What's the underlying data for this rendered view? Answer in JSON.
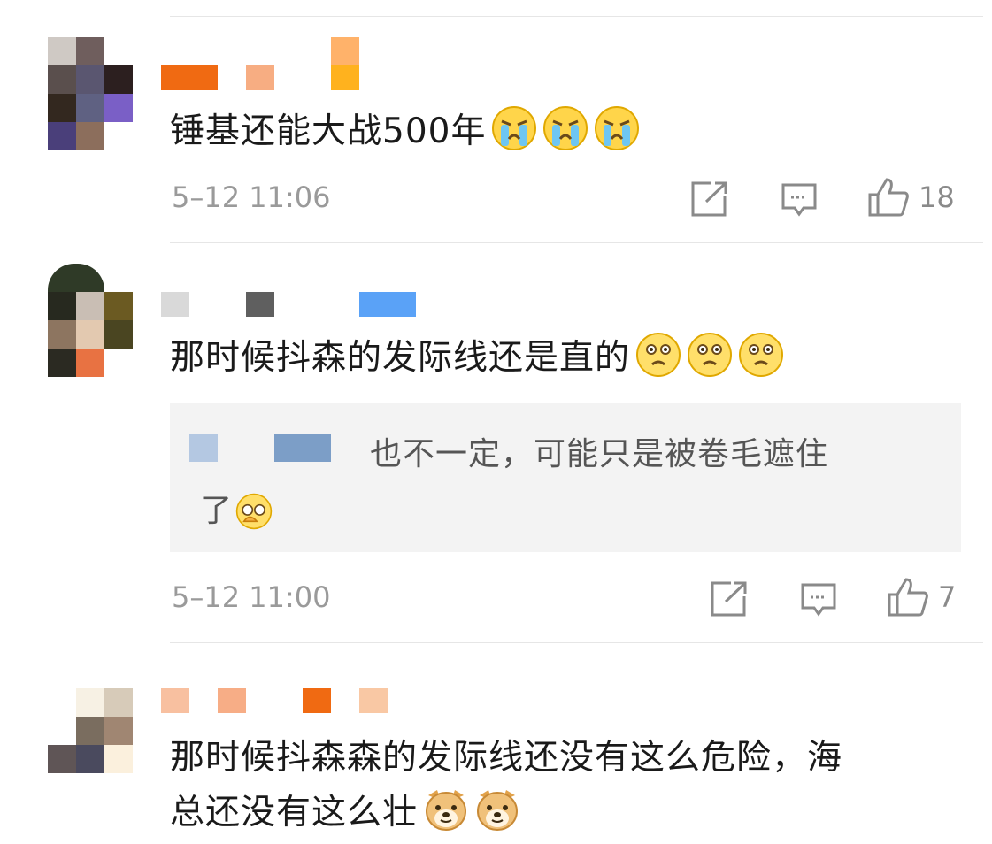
{
  "comments": [
    {
      "text": "锤基还能大战500年",
      "emojis": [
        "crying-face-emoji",
        "crying-face-emoji",
        "crying-face-emoji"
      ],
      "time": "5–12 11:06",
      "likes": "18"
    },
    {
      "text": "那时候抖森的发际线还是直的",
      "emojis": [
        "sad-face-emoji",
        "sad-face-emoji",
        "sad-face-emoji"
      ],
      "reply": {
        "line1": "也不一定，可能只是被卷毛遮住",
        "line2": "了",
        "emoji": "facepalm-emoji"
      },
      "time": "5–12 11:00",
      "likes": "7"
    },
    {
      "line1": "那时候抖森森的发际线还没有这么危险，海",
      "line2": "总还没有这么壮",
      "emojis": [
        "doge-emoji",
        "doge-emoji"
      ]
    }
  ],
  "colors": {
    "divider": "#e6e6e6",
    "reply_bg": "#f3f3f3",
    "icon": "#8a8a8a",
    "time": "#9a9a9a"
  },
  "icons": [
    "forward-icon",
    "reply-icon",
    "like-icon"
  ]
}
